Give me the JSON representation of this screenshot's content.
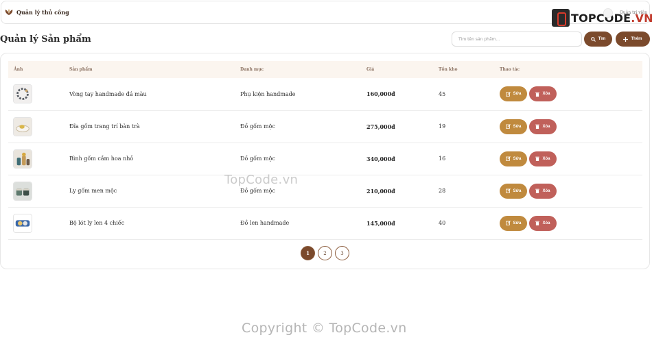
{
  "navbar": {
    "brand": "Quản lý thủ công",
    "logo_text": "TOPCODE",
    "logo_suffix": ".VN",
    "user": "Quản trị viên"
  },
  "page": {
    "title": "Quản lý Sản phẩm",
    "search_placeholder": "Tìm tên sản phẩm...",
    "search_button": "Tìm",
    "add_button": "Thêm"
  },
  "table": {
    "headers": [
      "Ảnh",
      "Sản phẩm",
      "Danh mục",
      "Giá",
      "Tồn kho",
      "Thao tác"
    ],
    "rows": [
      {
        "name": "Vòng tay handmade đá màu",
        "category": "Phụ kiện handmade",
        "price": "160,000đ",
        "stock": "45",
        "image": "bracelet-image"
      },
      {
        "name": "Đĩa gốm trang trí bàn trà",
        "category": "Đồ gốm mộc",
        "price": "275,000đ",
        "stock": "19",
        "image": "ceramic-plate-image"
      },
      {
        "name": "Bình gốm cắm hoa nhỏ",
        "category": "Đồ gốm mộc",
        "price": "340,000đ",
        "stock": "16",
        "image": "ceramic-vase-image"
      },
      {
        "name": "Ly gốm men mộc",
        "category": "Đồ gốm mộc",
        "price": "210,000đ",
        "stock": "28",
        "image": "ceramic-cup-image"
      },
      {
        "name": "Bộ lót ly len 4 chiếc",
        "category": "Đồ len handmade",
        "price": "145,000đ",
        "stock": "40",
        "image": "wool-coaster-image"
      }
    ],
    "edit_label": "Sửa",
    "delete_label": "Xóa"
  },
  "pagination": {
    "pages": [
      "1",
      "2",
      "3"
    ],
    "current": "1"
  },
  "watermarks": {
    "middle": "TopCode.vn",
    "footer": "Copyright © TopCode.vn"
  },
  "colors": {
    "primary": "#7b4a2c",
    "edit": "#c08a3e",
    "delete": "#c0605a",
    "header_bg": "#fbf5ef"
  }
}
